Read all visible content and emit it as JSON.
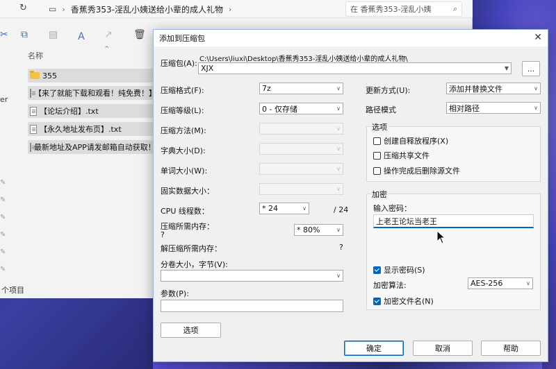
{
  "explorer": {
    "path": [
      "香蕉秀353-淫乱小姨送给小辈的成人礼物"
    ],
    "search_placeholder": "在 香蕉秀353-淫乱小姨",
    "column_name": "名称",
    "left_partial": "er",
    "files": [
      {
        "name": "355",
        "type": "folder"
      },
      {
        "name": "【来了就能下载和观看！纯免费！】",
        "type": "txt"
      },
      {
        "name": "【论坛介绍】.txt",
        "type": "txt"
      },
      {
        "name": "【永久地址发布页】.txt",
        "type": "txt"
      },
      {
        "name": "最新地址及APP请发邮箱自动获取！",
        "type": "txt"
      }
    ],
    "status": "个项目"
  },
  "dialog": {
    "title": "添加到压缩包",
    "archive_label": "压缩包(A):",
    "archive_dir": "C:\\Users\\liuxi\\Desktop\\香蕉秀353-淫乱小姨送给小辈的成人礼物\\",
    "archive_name": "XJX",
    "browse_label": "...",
    "format_label": "压缩格式(F):",
    "format_value": "7z",
    "level_label": "压缩等级(L):",
    "level_value": "0 - 仅存储",
    "method_label": "压缩方法(M):",
    "dict_label": "字典大小(D):",
    "word_label": "单词大小(W):",
    "solid_label": "固实数据大小：",
    "threads_label": "CPU 线程数：",
    "threads_value": "* 24",
    "threads_max": "/ 24",
    "mem_label": "压缩所需内存：",
    "mem_q": "?",
    "mem_value": "* 80%",
    "decomp_label": "解压缩所需内存：",
    "decomp_q": "?",
    "split_label": "分卷大小，字节(V):",
    "params_label": "参数(P):",
    "options_btn": "选项",
    "update_label": "更新方式(U):",
    "update_value": "添加并替换文件",
    "path_label": "路径模式",
    "path_value": "相对路径",
    "options_group": "选项",
    "opt_sfx": "创建自释放程序(X)",
    "opt_share": "压缩共享文件",
    "opt_delete": "操作完成后删除源文件",
    "enc_group": "加密",
    "pw_label": "输入密码：",
    "pw_value": "上老王论坛当老王",
    "show_pw": "显示密码(S)",
    "enc_method_label": "加密算法:",
    "enc_method_value": "AES-256",
    "enc_names": "加密文件名(N)",
    "ok": "确定",
    "cancel": "取消",
    "help": "帮助"
  }
}
